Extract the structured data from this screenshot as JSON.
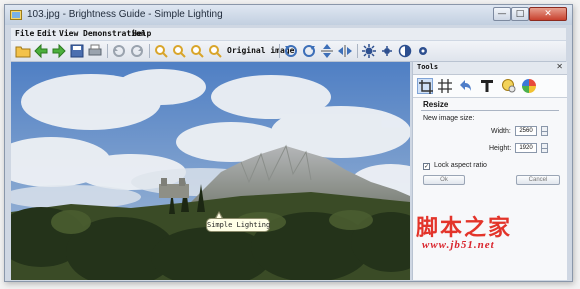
{
  "window": {
    "title": "103.jpg - Brightness Guide - Simple Lighting",
    "controls": {
      "minimize": "—",
      "maximize": "□",
      "close": "✕"
    }
  },
  "menu": {
    "items": [
      "File",
      "Edit",
      "View",
      "Demonstration",
      "Help"
    ]
  },
  "toolbar": {
    "original_label": "Original image",
    "icons": [
      "open-folder-icon",
      "back-arrow-icon",
      "forward-arrow-icon",
      "save-icon",
      "print-icon",
      "undo-icon",
      "redo-icon",
      "zoom-in-icon",
      "zoom-out-icon",
      "zoom-fit-icon",
      "zoom-actual-icon",
      "rotate-left-icon",
      "rotate-right-icon",
      "flip-vertical-icon",
      "flip-horizontal-icon",
      "brightness-icon",
      "settings-icon",
      "contrast-icon",
      "filter-icon"
    ]
  },
  "canvas": {
    "tooltip": "Simple Lighting"
  },
  "tools_panel": {
    "title": "Tools",
    "close": "✕",
    "icons": [
      "crop-icon",
      "grid-icon",
      "undo-arrow-icon",
      "text-icon",
      "paint-icon",
      "color-wheel-icon"
    ],
    "section_title": "Resize",
    "new_image_size_label": "New image size:",
    "width_label": "Width:",
    "width_value": "2560",
    "height_label": "Height:",
    "height_value": "1920",
    "lock_label": "Lock aspect ratio",
    "lock_checked": true,
    "ok_label": "Ok",
    "cancel_label": "Cancel"
  },
  "watermark": {
    "chinese": "脚本之家",
    "url": "www.jb51.net"
  },
  "colors": {
    "title_bar": "#c2cfe0",
    "toolbar": "#dfe4ec",
    "sky": "#6a8fc8",
    "forest": "#2c3a1c",
    "watermark": "#e3342a",
    "close_button": "#c8412e"
  }
}
